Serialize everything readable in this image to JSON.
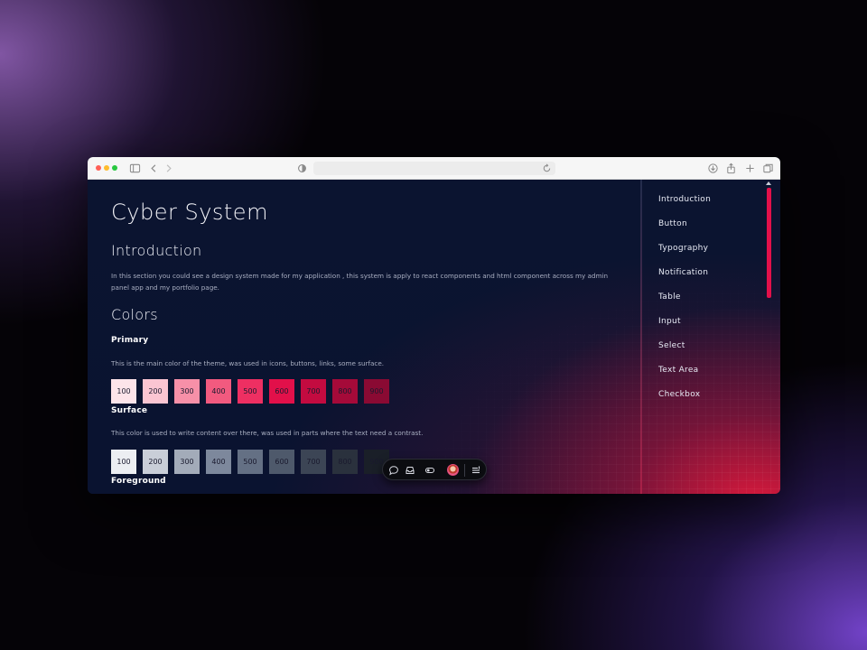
{
  "browser": {
    "address_text": ""
  },
  "page": {
    "title": "Cyber System",
    "introduction": {
      "heading": "Introduction",
      "text": "In this section you could see a design system made for my application , this system is apply to react components and html component across my admin panel app and my portfolio page."
    },
    "colors": {
      "heading": "Colors",
      "groups": [
        {
          "name": "Primary",
          "description": "This is the main color of the theme, was used in icons, buttons, links, some surface.",
          "swatches": [
            {
              "label": "100",
              "color": "#fde4ea",
              "text_color": "#1a1a2e"
            },
            {
              "label": "200",
              "color": "#fbc5d2",
              "text_color": "#1a1a2e"
            },
            {
              "label": "300",
              "color": "#f790a8",
              "text_color": "#1a1a2e"
            },
            {
              "label": "400",
              "color": "#f25a7f",
              "text_color": "#1a1a2e"
            },
            {
              "label": "500",
              "color": "#ee2f62",
              "text_color": "#1a1a2e"
            },
            {
              "label": "600",
              "color": "#e2104a",
              "text_color": "#1a1a2e"
            },
            {
              "label": "700",
              "color": "#c30b40",
              "text_color": "#1a1a2e"
            },
            {
              "label": "800",
              "color": "#a50a39",
              "text_color": "#1a1a2e"
            },
            {
              "label": "900",
              "color": "#8a0a33",
              "text_color": "#1a1a2e"
            }
          ]
        },
        {
          "name": "Surface",
          "description": "This color is used to write content over there, was used in parts where the text need a contrast.",
          "swatches": [
            {
              "label": "100",
              "color": "#eceef2",
              "text_color": "#1a1a2e"
            },
            {
              "label": "200",
              "color": "#c9ced8",
              "text_color": "#1a1a2e"
            },
            {
              "label": "300",
              "color": "#a3abb9",
              "text_color": "#1a1a2e"
            },
            {
              "label": "400",
              "color": "#7d889c",
              "text_color": "#1a1a2e"
            },
            {
              "label": "500",
              "color": "#647084",
              "text_color": "#1a1a2e"
            },
            {
              "label": "600",
              "color": "#4e596b",
              "text_color": "#1a1a2e"
            },
            {
              "label": "700",
              "color": "#3c4555",
              "text_color": "#1a1a2e"
            },
            {
              "label": "800",
              "color": "#2a313d",
              "text_color": "#1a1a2e"
            },
            {
              "label": "900",
              "color": "#1a1f28",
              "text_color": "#1a1a2e"
            }
          ]
        },
        {
          "name": "Foreground"
        }
      ]
    }
  },
  "nav": {
    "items": [
      "Introduction",
      "Button",
      "Typography",
      "Notification",
      "Table",
      "Input",
      "Select",
      "Text Area",
      "Checkbox"
    ]
  },
  "devbar": {
    "icons": [
      "comment-icon",
      "inbox-icon",
      "toggle-icon",
      "avatar",
      "menu-icon"
    ]
  },
  "colors": {
    "accent": "#e2104a",
    "background": "#0a1330"
  }
}
